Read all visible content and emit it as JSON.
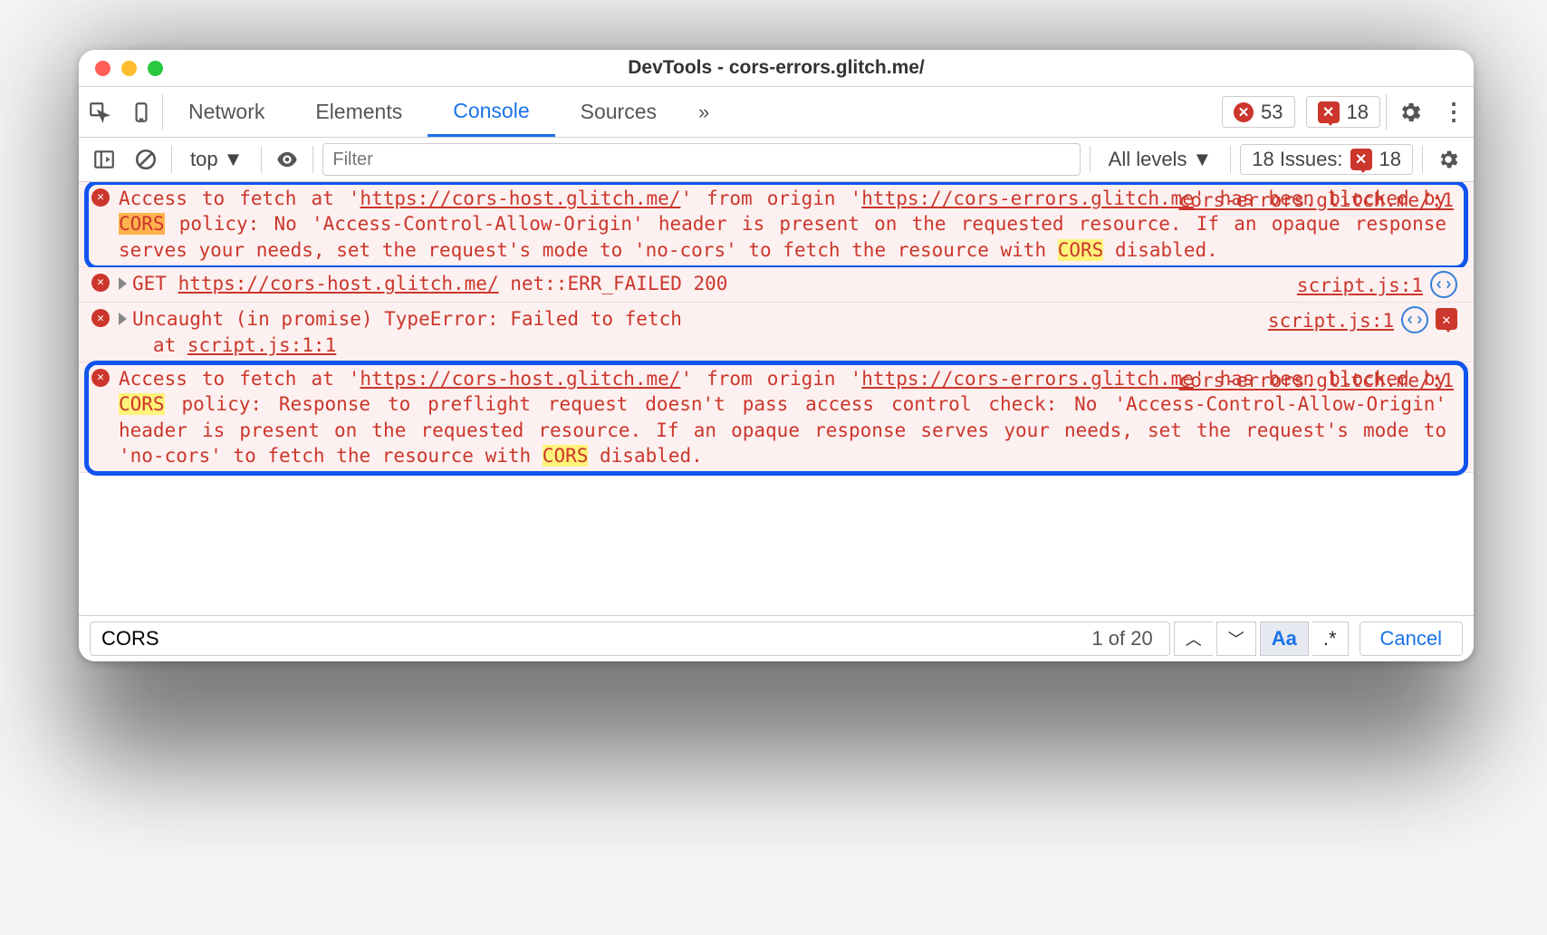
{
  "window": {
    "title": "DevTools - cors-errors.glitch.me/"
  },
  "tabs": {
    "items": [
      "Network",
      "Elements",
      "Console",
      "Sources"
    ],
    "overflow": "»",
    "active_index": 2
  },
  "header_counts": {
    "errors": "53",
    "issues": "18"
  },
  "toolbar": {
    "context": "top",
    "filter_placeholder": "Filter",
    "levels_label": "All levels",
    "issues_label": "18 Issues:",
    "issues_count": "18"
  },
  "messages": [
    {
      "id": "m1",
      "kind": "error",
      "source": "cors-errors.glitch.me/:1",
      "pre1": "Access to fetch at '",
      "link1": "https://cors-host.glitch.me/",
      "mid1": "' from origin '",
      "link2": "https://cors-errors.glitch.me",
      "mid2": "' has been blocked by ",
      "cors1": "CORS",
      "mid3": " policy: No 'Access-Control-Allow-Origin' header is present on the requested resource. If an opaque response serves your needs, set the request's mode to 'no-cors' to fetch the resource with ",
      "cors2": "CORS",
      "post": " disabled."
    },
    {
      "id": "m2",
      "kind": "net",
      "source": "script.js:1",
      "pre": "GET ",
      "link": "https://cors-host.glitch.me/",
      "post": " net::ERR_FAILED 200"
    },
    {
      "id": "m3",
      "kind": "exception",
      "source": "script.js:1",
      "line1": "Uncaught (in promise) TypeError: Failed to fetch",
      "at": "   at ",
      "atlink": "script.js:1:1"
    },
    {
      "id": "m4",
      "kind": "error",
      "source": "cors-errors.glitch.me/:1",
      "pre1": "Access to fetch at '",
      "link1": "https://cors-host.glitch.me/",
      "mid1": "' from origin '",
      "link2": "https://cors-errors.glitch.me",
      "mid2": "' has been blocked by ",
      "cors1": "CORS",
      "mid3": " policy: Response to preflight request doesn't pass access control check: No 'Access-Control-Allow-Origin' header is present on the requested resource. If an opaque response serves your needs, set the request's mode to 'no-cors' to fetch the resource with ",
      "cors2": "CORS",
      "post": " disabled."
    }
  ],
  "find": {
    "query": "CORS",
    "count": "1 of 20",
    "match_case": "Aa",
    "regex": ".*",
    "cancel": "Cancel"
  }
}
